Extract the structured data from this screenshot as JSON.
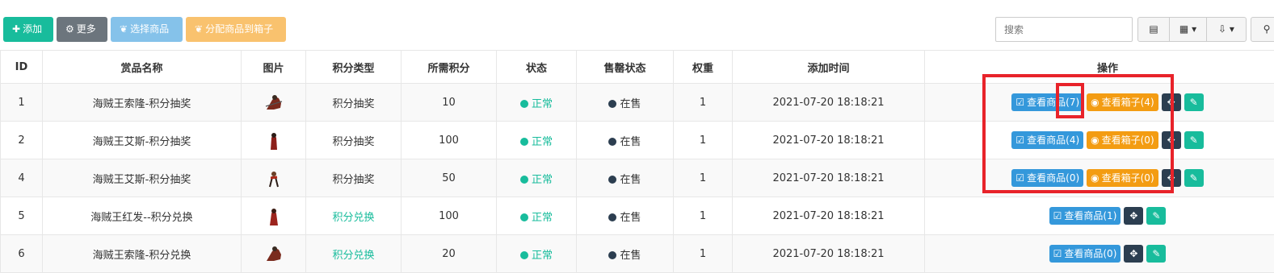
{
  "toolbar": {
    "add_label": "添加",
    "more_label": "更多",
    "select_label": "选择商品",
    "assign_label": "分配商品到箱子",
    "search_placeholder": "搜索",
    "icons": [
      "plus-icon",
      "gear-icon",
      "leaf-icon",
      "leaf-icon",
      "list-view-icon",
      "grid-columns-icon",
      "export-icon",
      "search-icon"
    ]
  },
  "table": {
    "headers": [
      "ID",
      "赏品名称",
      "图片",
      "积分类型",
      "所需积分",
      "状态",
      "售罄状态",
      "权重",
      "添加时间",
      "操作"
    ],
    "rows": [
      {
        "id": "1",
        "name": "海贼王索隆-积分抽奖",
        "type": "积分抽奖",
        "type_green": false,
        "points": "10",
        "status": "正常",
        "sold": "在售",
        "weight": "1",
        "time": "2021-07-20 18:18:21",
        "goods_btn": "查看商品(7)",
        "box_btn": "查看箱子(4)"
      },
      {
        "id": "2",
        "name": "海贼王艾斯-积分抽奖",
        "type": "积分抽奖",
        "type_green": false,
        "points": "100",
        "status": "正常",
        "sold": "在售",
        "weight": "1",
        "time": "2021-07-20 18:18:21",
        "goods_btn": "查看商品(4)",
        "box_btn": "查看箱子(0)"
      },
      {
        "id": "4",
        "name": "海贼王艾斯-积分抽奖",
        "type": "积分抽奖",
        "type_green": false,
        "points": "50",
        "status": "正常",
        "sold": "在售",
        "weight": "1",
        "time": "2021-07-20 18:18:21",
        "goods_btn": "查看商品(0)",
        "box_btn": "查看箱子(0)"
      },
      {
        "id": "5",
        "name": "海贼王红发--积分兑换",
        "type": "积分兑换",
        "type_green": true,
        "points": "100",
        "status": "正常",
        "sold": "在售",
        "weight": "1",
        "time": "2021-07-20 18:18:21",
        "goods_btn": "查看商品(1)",
        "box_btn": null
      },
      {
        "id": "6",
        "name": "海贼王索隆-积分兑换",
        "type": "积分兑换",
        "type_green": true,
        "points": "20",
        "status": "正常",
        "sold": "在售",
        "weight": "1",
        "time": "2021-07-20 18:18:21",
        "goods_btn": "查看商品(0)",
        "box_btn": null
      }
    ]
  },
  "colors": {
    "accent": "#18bc9c",
    "highlight": "#e8232a",
    "blue": "#3498db",
    "orange": "#f39c12",
    "dark": "#2c3e50"
  }
}
